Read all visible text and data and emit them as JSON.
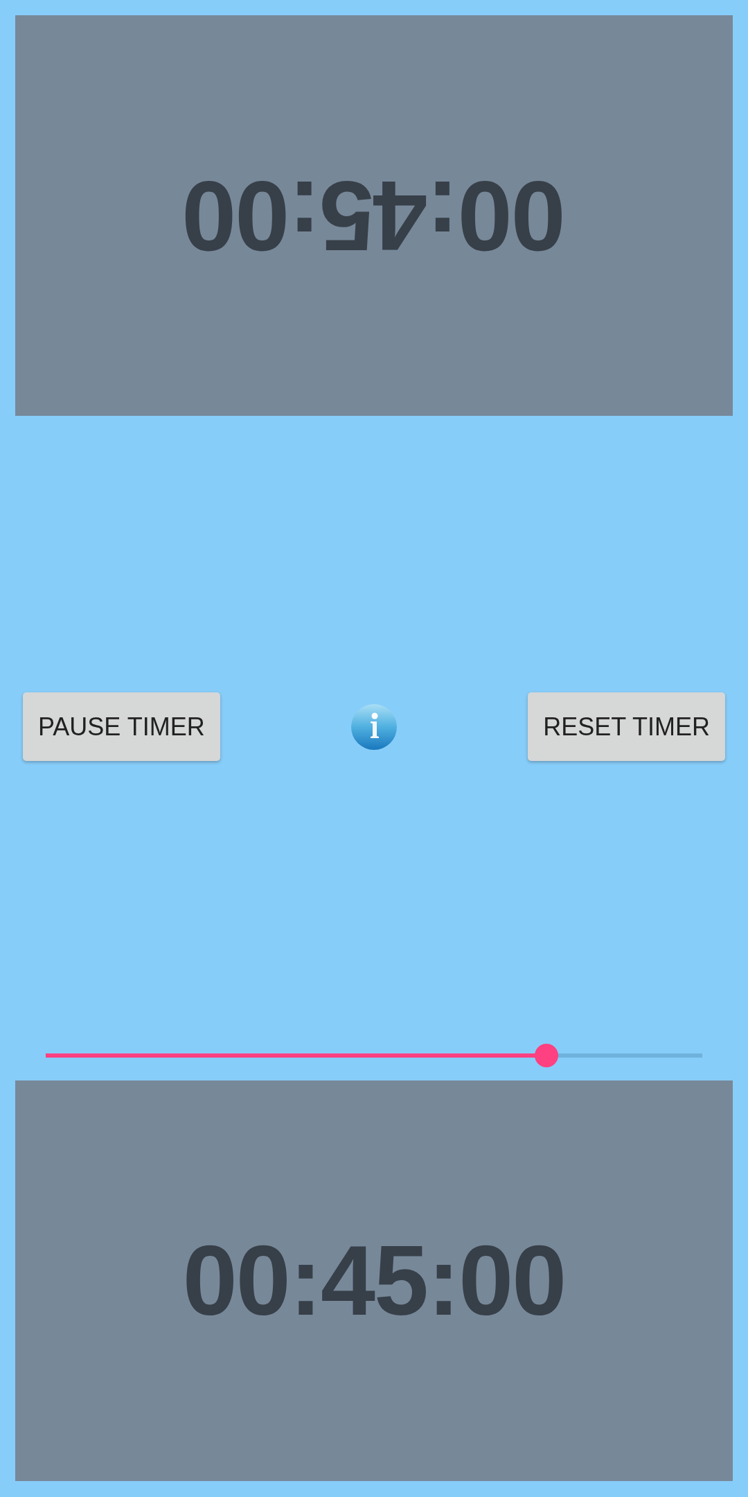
{
  "top_timer": {
    "flipped": true,
    "time": "00:45:00"
  },
  "controls": [
    {
      "kind": "button",
      "label": "PAUSE TIMER"
    },
    {
      "kind": "info"
    },
    {
      "kind": "button",
      "label": "RESET TIMER"
    }
  ],
  "slider": {
    "level": 0.763
  },
  "bottom_timer": {
    "flipped": false,
    "time": "00:45:00"
  }
}
